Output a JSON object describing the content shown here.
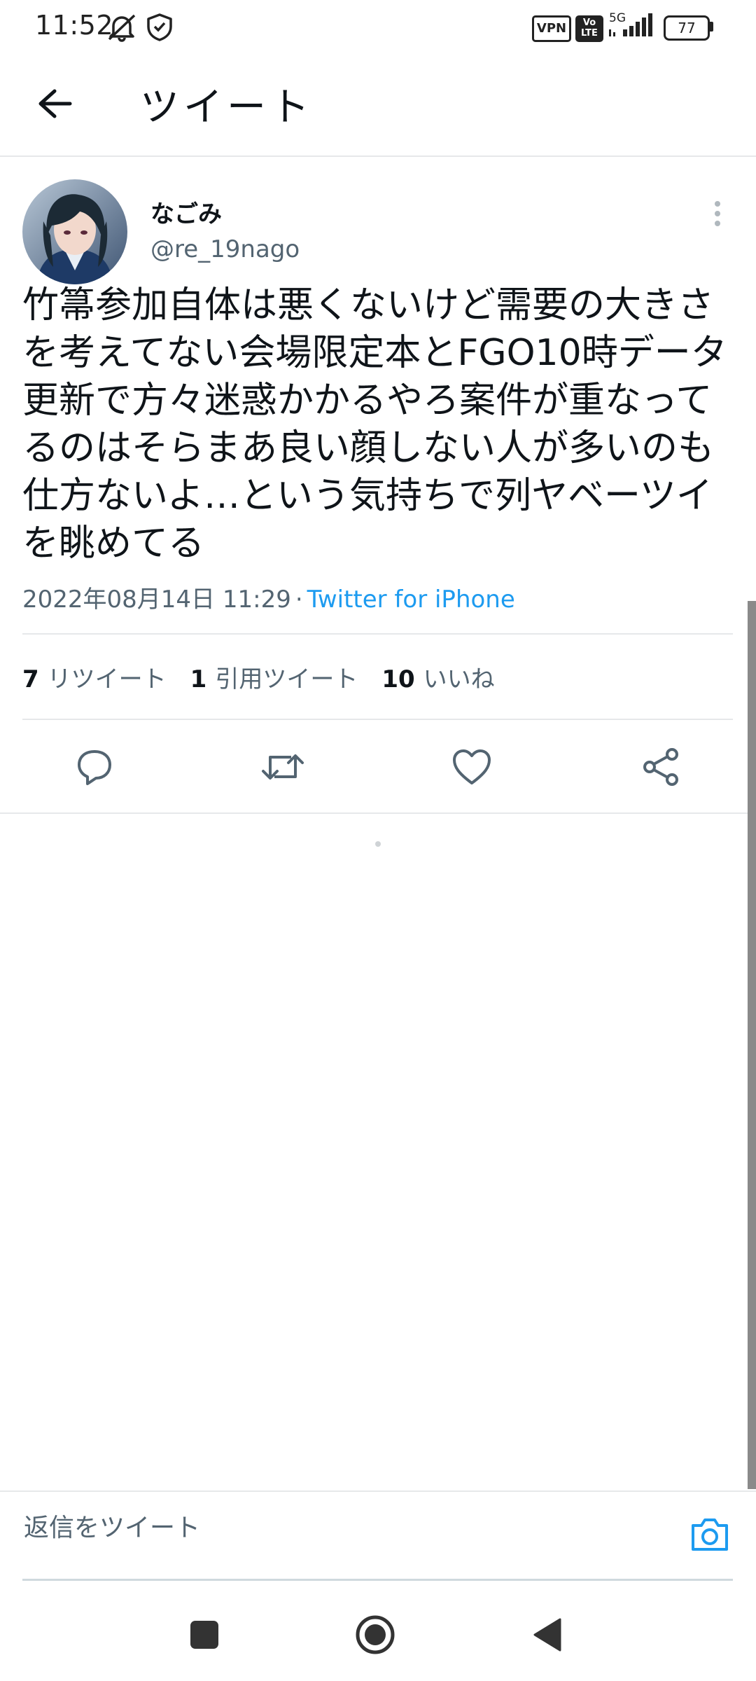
{
  "status_bar": {
    "time": "11:52",
    "vpn_badge": "VPN",
    "volte_badge": "Vo LTE",
    "network_type": "5G",
    "battery_level": "77",
    "icons": [
      "mute-vibrate-icon",
      "shield-check-icon",
      "signal-icon"
    ]
  },
  "header": {
    "title": "ツイート",
    "back_icon": "arrow-left-icon"
  },
  "tweet": {
    "display_name": "なごみ",
    "handle": "@re_19nago",
    "text": "竹箒参加自体は悪くないけど需要の大きさを考えてない会場限定本とFGO10時データ更新で方々迷惑かかるやろ案件が重なってるのはそらまあ良い顔しない人が多いのも仕方ないよ…という気持ちで列ヤベーツイを眺めてる",
    "timestamp": "2022年08月14日 11:29",
    "separator": "·",
    "source": "Twitter for iPhone",
    "stats": {
      "retweets_count": "7",
      "retweets_label": "リツイート",
      "quotes_count": "1",
      "quotes_label": "引用ツイート",
      "likes_count": "10",
      "likes_label": "いいね"
    },
    "actions": [
      "reply-icon",
      "retweet-icon",
      "like-icon",
      "share-icon"
    ]
  },
  "reply_bar": {
    "placeholder": "返信をツイート",
    "camera_icon": "camera-icon"
  },
  "nav_bar": {
    "buttons": [
      "recent-apps-icon",
      "home-icon",
      "back-triangle-icon"
    ]
  },
  "colors": {
    "accent": "#1d9bf0",
    "text_primary": "#0f1419",
    "text_secondary": "#536471",
    "divider": "#e6e8ea"
  }
}
